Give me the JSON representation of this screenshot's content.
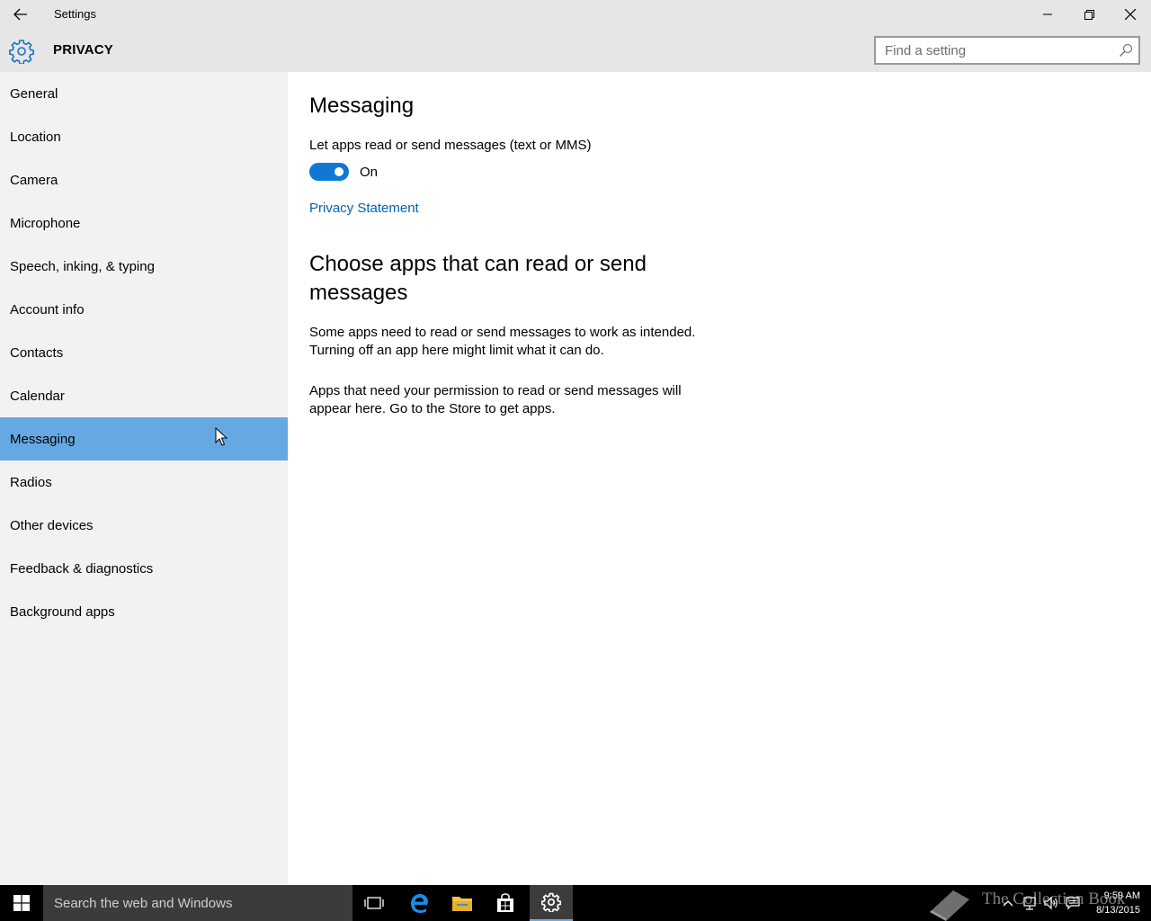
{
  "window": {
    "title": "Settings"
  },
  "header": {
    "section": "PRIVACY",
    "search_placeholder": "Find a setting"
  },
  "sidebar": {
    "items": [
      {
        "label": "General"
      },
      {
        "label": "Location"
      },
      {
        "label": "Camera"
      },
      {
        "label": "Microphone"
      },
      {
        "label": "Speech, inking, & typing"
      },
      {
        "label": "Account info"
      },
      {
        "label": "Contacts"
      },
      {
        "label": "Calendar"
      },
      {
        "label": "Messaging",
        "selected": true
      },
      {
        "label": "Radios"
      },
      {
        "label": "Other devices"
      },
      {
        "label": "Feedback & diagnostics"
      },
      {
        "label": "Background apps"
      }
    ]
  },
  "main": {
    "title": "Messaging",
    "toggle_label": "Let apps read or send messages (text or MMS)",
    "toggle_state": "On",
    "toggle_on": true,
    "privacy_link": "Privacy Statement",
    "choose_heading": "Choose apps that can read or send messages",
    "paragraph1": "Some apps need to read or send messages to work as intended. Turning off an app here might limit what it can do.",
    "paragraph2": "Apps that need your permission to read or send messages will appear here. Go to the Store to get apps."
  },
  "taskbar": {
    "search_text": "Search the web and Windows",
    "watermark": "The Collection Book",
    "time": "9:59 AM",
    "date": "8/13/2015"
  },
  "colors": {
    "accent": "#0f78d4",
    "selected_item": "#65a8e2",
    "link": "#0063b1",
    "sidebar_bg": "#f2f2f2",
    "titlebar_bg": "#e6e6e6"
  }
}
